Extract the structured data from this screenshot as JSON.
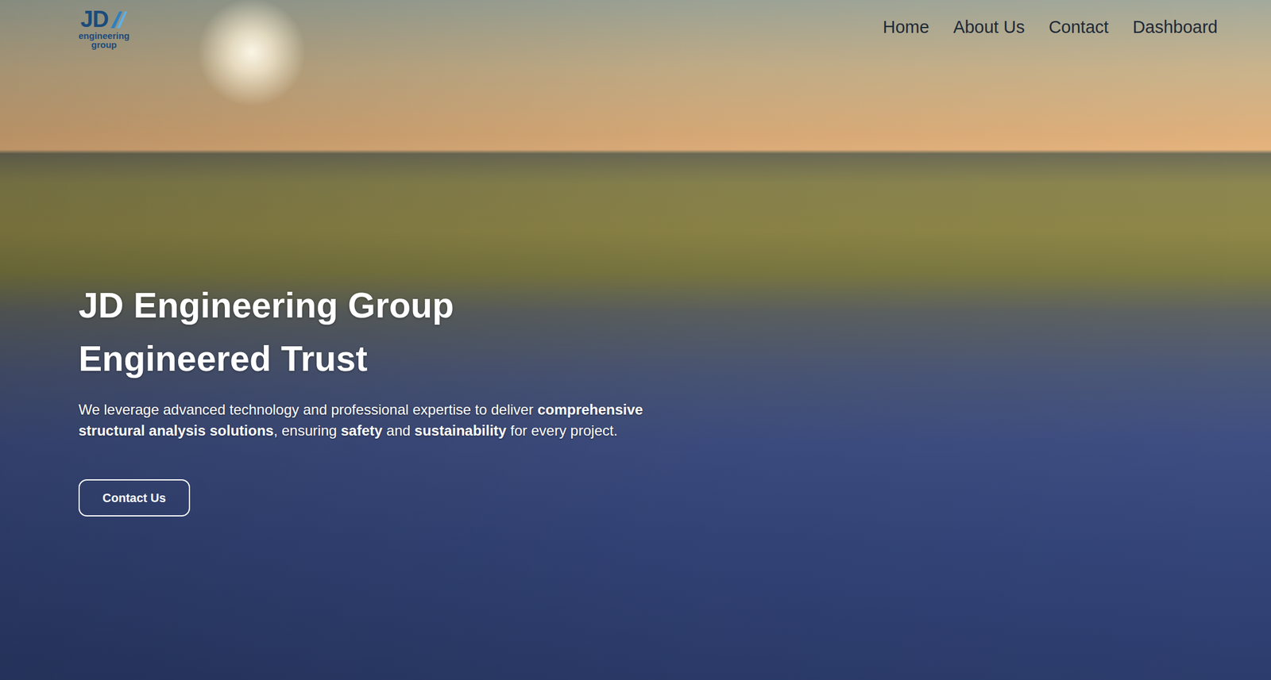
{
  "logo": {
    "mark": "JD",
    "line1": "engineering",
    "line2": "group"
  },
  "nav": [
    {
      "label": "Home"
    },
    {
      "label": "About Us"
    },
    {
      "label": "Contact"
    },
    {
      "label": "Dashboard"
    }
  ],
  "hero": {
    "title_lines": [
      "JD Engineering Group",
      "Engineered Trust"
    ],
    "description": [
      {
        "text": "We leverage advanced technology and professional expertise to deliver ",
        "bold": false
      },
      {
        "text": "comprehensive structural analysis solutions",
        "bold": true
      },
      {
        "text": ", ensuring ",
        "bold": false
      },
      {
        "text": "safety",
        "bold": true
      },
      {
        "text": " and ",
        "bold": false
      },
      {
        "text": "sustainability",
        "bold": true
      },
      {
        "text": " for every project.",
        "bold": false
      }
    ],
    "button": "Contact Us"
  }
}
